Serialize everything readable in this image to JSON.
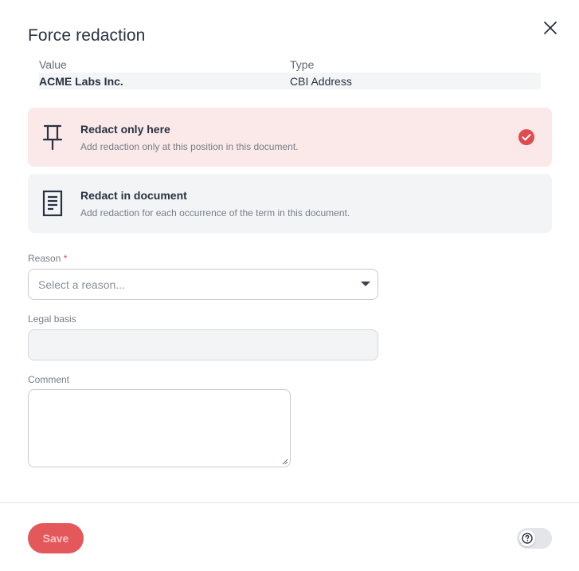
{
  "dialog": {
    "title": "Force redaction"
  },
  "table": {
    "headers": [
      "Value",
      "Type"
    ],
    "row": [
      "ACME Labs Inc.",
      "CBI Address"
    ]
  },
  "options": [
    {
      "title": "Redact only here",
      "description": "Add redaction only at this position in this document.",
      "icon": "pin-icon",
      "selected": true
    },
    {
      "title": "Redact in document",
      "description": "Add redaction for each occurrence of the term in this document.",
      "icon": "document-icon",
      "selected": false
    }
  ],
  "form": {
    "reason_label": "Reason",
    "reason_required_mark": "*",
    "reason_placeholder": "Select a reason...",
    "legal_basis_label": "Legal basis",
    "legal_basis_value": "",
    "comment_label": "Comment",
    "comment_value": ""
  },
  "footer": {
    "save_label": "Save",
    "help_toggle_on": false
  },
  "colors": {
    "accent": "#e4575a",
    "selected_bg": "#fbe9e9",
    "check": "#dd4d50"
  }
}
